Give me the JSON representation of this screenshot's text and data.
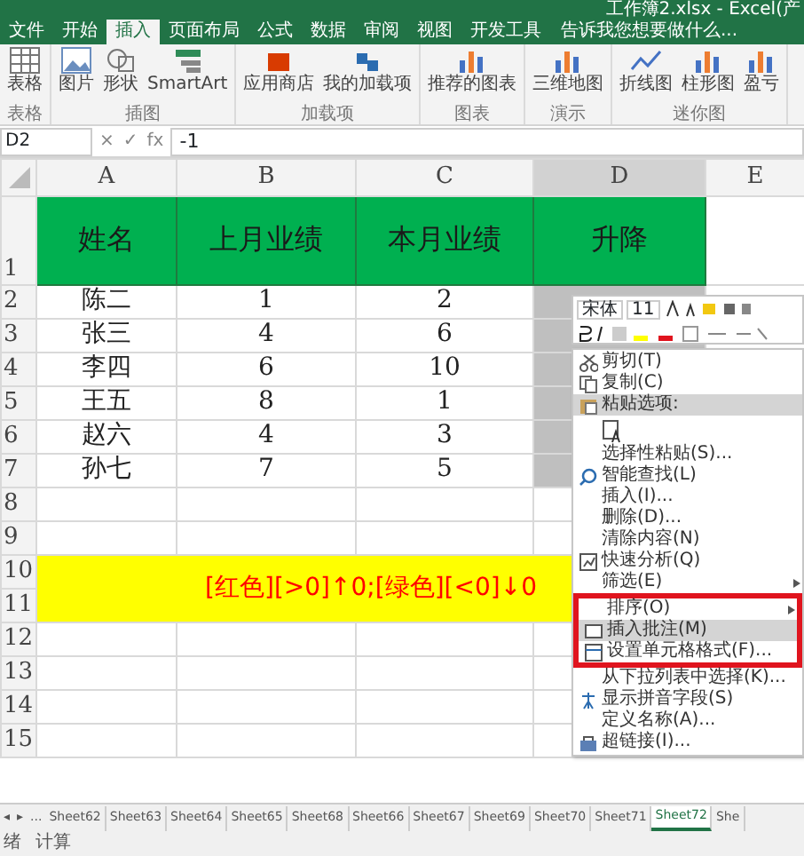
{
  "title_bar": {
    "title": "工作簿2.xlsx - Excel(产"
  },
  "tabs": [
    {
      "label": "文件",
      "selected": false
    },
    {
      "label": "开始",
      "selected": false
    },
    {
      "label": "插入",
      "selected": true
    },
    {
      "label": "页面布局",
      "selected": false
    },
    {
      "label": "公式",
      "selected": false
    },
    {
      "label": "数据",
      "selected": false
    },
    {
      "label": "审阅",
      "selected": false
    },
    {
      "label": "视图",
      "selected": false
    },
    {
      "label": "开发工具",
      "selected": false
    }
  ],
  "tell_me": {
    "placeholder": "告诉我您想要做什么..."
  },
  "ribbon": {
    "groups": [
      {
        "label": "表格",
        "buttons": [
          {
            "label": "表格"
          }
        ]
      },
      {
        "label": "插图",
        "buttons": [
          {
            "label": "图片"
          },
          {
            "label": "形状"
          },
          {
            "label": "SmartArt"
          }
        ]
      },
      {
        "label": "加载项",
        "buttons": [
          {
            "label": "应用商店"
          },
          {
            "label": "我的加载项"
          }
        ]
      },
      {
        "label": "图表",
        "buttons": [
          {
            "label": "推荐的图表"
          }
        ]
      },
      {
        "label": "演示",
        "buttons": [
          {
            "label": "三维地图"
          }
        ]
      },
      {
        "label": "迷你图",
        "buttons": [
          {
            "label": "折线图"
          },
          {
            "label": "柱形图"
          },
          {
            "label": "盈亏"
          }
        ]
      }
    ]
  },
  "formula_bar": {
    "name_box": "D2",
    "buttons": [
      "×",
      "✓",
      "fx"
    ],
    "formula": "-1"
  },
  "grid": {
    "columns": [
      {
        "label": "A",
        "selected": false
      },
      {
        "label": "B",
        "selected": false
      },
      {
        "label": "C",
        "selected": false
      },
      {
        "label": "D",
        "selected": true
      },
      {
        "label": "E",
        "selected": false
      }
    ],
    "rows": [
      {
        "kind": "header",
        "number": "1",
        "cells": [
          "姓名",
          "上月业绩",
          "本月业绩",
          "升降"
        ]
      },
      {
        "kind": "data",
        "number": "2",
        "cells": [
          "陈二",
          "1",
          "2"
        ],
        "d_selected": true
      },
      {
        "kind": "data",
        "number": "3",
        "cells": [
          "张三",
          "4",
          "6"
        ],
        "d_selected": true
      },
      {
        "kind": "data",
        "number": "4",
        "cells": [
          "李四",
          "6",
          "10"
        ],
        "d_selected": true
      },
      {
        "kind": "data",
        "number": "5",
        "cells": [
          "王五",
          "8",
          "1"
        ],
        "d_selected": true
      },
      {
        "kind": "data",
        "number": "6",
        "cells": [
          "赵六",
          "4",
          "3"
        ],
        "d_selected": true
      },
      {
        "kind": "data",
        "number": "7",
        "cells": [
          "孙七",
          "7",
          "5"
        ],
        "d_selected": true
      },
      {
        "kind": "empty",
        "number": "8"
      },
      {
        "kind": "empty",
        "number": "9"
      },
      {
        "kind": "banner",
        "numbers": [
          "10",
          "11"
        ],
        "text": "[红色][>0]↑0;[绿色][<0]↓0"
      },
      {
        "kind": "empty",
        "number": "12"
      },
      {
        "kind": "empty",
        "number": "13"
      },
      {
        "kind": "empty",
        "number": "14"
      },
      {
        "kind": "empty",
        "number": "15"
      }
    ]
  },
  "mini_toolbar": {
    "font": "宋体",
    "size": "11"
  },
  "context_menu": [
    {
      "kind": "item",
      "label": "剪切(T)",
      "boxed": false,
      "highlighted": false
    },
    {
      "kind": "item",
      "label": "复制(C)",
      "boxed": false,
      "highlighted": false
    },
    {
      "kind": "item",
      "label": "粘贴选项:",
      "boxed": false,
      "highlighted": true
    },
    {
      "kind": "paste-options"
    },
    {
      "kind": "item",
      "label": "选择性粘贴(S)...",
      "boxed": false,
      "highlighted": false
    },
    {
      "kind": "item",
      "label": "智能查找(L)",
      "boxed": false,
      "highlighted": false
    },
    {
      "kind": "item",
      "label": "插入(I)...",
      "boxed": false,
      "highlighted": false
    },
    {
      "kind": "item",
      "label": "删除(D)...",
      "boxed": false,
      "highlighted": false
    },
    {
      "kind": "item",
      "label": "清除内容(N)",
      "boxed": false,
      "highlighted": false
    },
    {
      "kind": "item",
      "label": "快速分析(Q)",
      "boxed": false,
      "highlighted": false
    },
    {
      "kind": "submenu",
      "label": "筛选(E)",
      "boxed": false,
      "highlighted": false
    },
    {
      "kind": "submenu",
      "label": "排序(O)",
      "boxed": true,
      "highlighted": false
    },
    {
      "kind": "item",
      "label": "插入批注(M)",
      "boxed": true,
      "highlighted": true
    },
    {
      "kind": "item",
      "label": "设置单元格格式(F)...",
      "boxed": true,
      "highlighted": false
    },
    {
      "kind": "item",
      "label": "从下拉列表中选择(K)...",
      "boxed": false,
      "highlighted": false
    },
    {
      "kind": "item",
      "label": "显示拼音字段(S)",
      "boxed": false,
      "highlighted": false
    },
    {
      "kind": "item",
      "label": "定义名称(A)...",
      "boxed": false,
      "highlighted": false
    },
    {
      "kind": "item",
      "label": "超链接(I)...",
      "boxed": false,
      "highlighted": false
    }
  ],
  "sheet_tabs": [
    {
      "label": "Sheet62",
      "selected": false
    },
    {
      "label": "Sheet63",
      "selected": false
    },
    {
      "label": "Sheet64",
      "selected": false
    },
    {
      "label": "Sheet65",
      "selected": false
    },
    {
      "label": "Sheet68",
      "selected": false
    },
    {
      "label": "Sheet66",
      "selected": false
    },
    {
      "label": "Sheet67",
      "selected": false
    },
    {
      "label": "Sheet69",
      "selected": false
    },
    {
      "label": "Sheet70",
      "selected": false
    },
    {
      "label": "Sheet71",
      "selected": false
    },
    {
      "label": "Sheet72",
      "selected": true
    },
    {
      "label": "She",
      "selected": false
    }
  ],
  "sheet_nav": [
    "◂",
    "▸",
    "..."
  ],
  "status_bar": {
    "items": [
      "绪",
      "计算"
    ]
  }
}
